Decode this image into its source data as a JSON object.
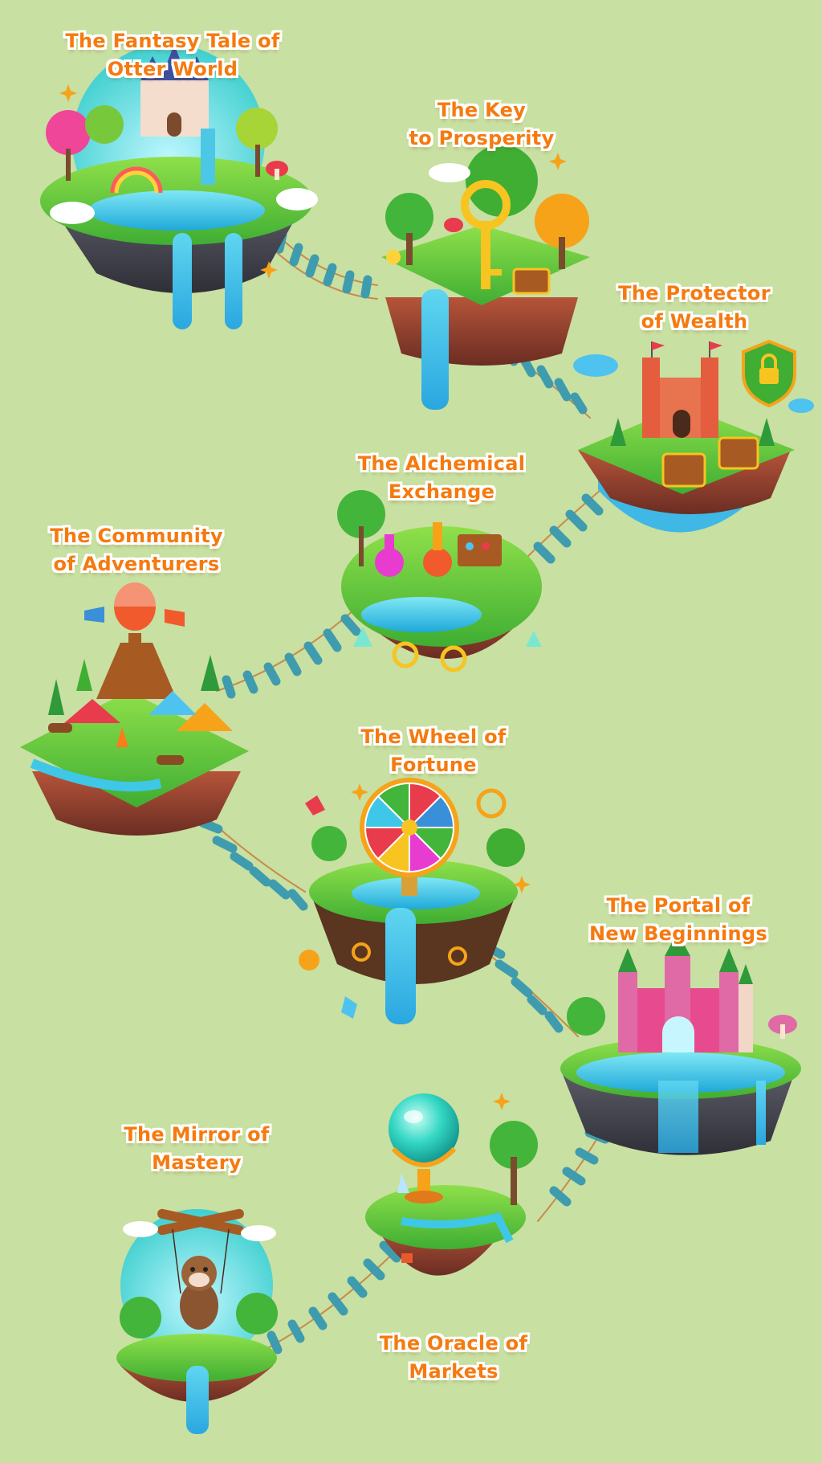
{
  "map": {
    "colors": {
      "background": "#c8e0a2",
      "label_text": "#f57a10",
      "label_outline": "#ffffff",
      "bridge_plank": "#3f9cae",
      "rope": "#c98a4a"
    },
    "locations": [
      {
        "id": "otter-world",
        "line1": "The Fantasy Tale of",
        "line2": "Otter World",
        "icon": "castle-island-icon"
      },
      {
        "id": "key-prosperity",
        "line1": "The Key",
        "line2": "to Prosperity",
        "icon": "golden-key-island-icon"
      },
      {
        "id": "protector-wealth",
        "line1": "The Protector",
        "line2": "of Wealth",
        "icon": "fortress-shield-island-icon"
      },
      {
        "id": "alchemical-exchange",
        "line1": "The Alchemical",
        "line2": "Exchange",
        "icon": "potion-island-icon"
      },
      {
        "id": "community-adventurers",
        "line1": "The Community",
        "line2": "of Adventurers",
        "icon": "campsite-island-icon"
      },
      {
        "id": "wheel-fortune",
        "line1": "The Wheel of",
        "line2": "Fortune",
        "icon": "fortune-wheel-island-icon"
      },
      {
        "id": "portal-beginnings",
        "line1": "The Portal of",
        "line2": "New Beginnings",
        "icon": "portal-castle-island-icon"
      },
      {
        "id": "mirror-mastery",
        "line1": "The Mirror of",
        "line2": "Mastery",
        "icon": "marionette-otter-island-icon"
      },
      {
        "id": "oracle-markets",
        "line1": "The Oracle of",
        "line2": "Markets",
        "icon": "crystal-ball-island-icon"
      }
    ]
  }
}
